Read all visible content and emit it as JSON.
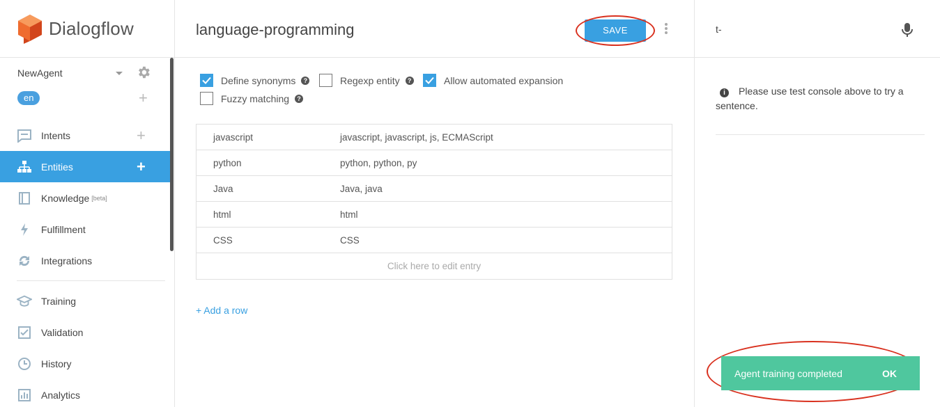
{
  "brand": {
    "name": "Dialogflow",
    "color": "#e8571d"
  },
  "agent": {
    "name": "NewAgent",
    "language": "en"
  },
  "sidebar": {
    "items": [
      {
        "label": "Intents",
        "icon": "chat-icon",
        "plus": "+"
      },
      {
        "label": "Entities",
        "icon": "sitemap-icon",
        "plus": "+",
        "active": true
      },
      {
        "label": "Knowledge",
        "icon": "book-icon",
        "badge": "[beta]"
      },
      {
        "label": "Fulfillment",
        "icon": "bolt-icon"
      },
      {
        "label": "Integrations",
        "icon": "sync-icon"
      },
      {
        "label": "Training",
        "icon": "graduation-cap-icon"
      },
      {
        "label": "Validation",
        "icon": "check-square-icon"
      },
      {
        "label": "History",
        "icon": "clock-icon"
      },
      {
        "label": "Analytics",
        "icon": "bar-chart-icon"
      }
    ],
    "plus": "+"
  },
  "main": {
    "title": "language-programming",
    "save_label": "SAVE",
    "options": [
      {
        "label": "Define synonyms",
        "checked": true,
        "help": "?"
      },
      {
        "label": "Regexp entity",
        "checked": false,
        "help": "?"
      },
      {
        "label": "Allow automated expansion",
        "checked": true
      },
      {
        "label": "Fuzzy matching",
        "checked": false,
        "help": "?"
      }
    ],
    "entries": [
      {
        "value": "javascript",
        "synonyms": "javascript, javascript, js, ECMAScript"
      },
      {
        "value": "python",
        "synonyms": "python, python, py"
      },
      {
        "value": "Java",
        "synonyms": "Java, java"
      },
      {
        "value": "html",
        "synonyms": "html"
      },
      {
        "value": "CSS",
        "synonyms": "CSS"
      }
    ],
    "edit_placeholder": "Click here to edit entry",
    "add_row": "+ Add a row"
  },
  "console": {
    "input_value": "t-",
    "info_icon": "i",
    "info_text": "Please use test console above to try a sentence.",
    "toast_text": "Agent training completed",
    "toast_ok": "OK",
    "toast_color": "#4fc79e"
  },
  "colors": {
    "accent": "#39a0e1",
    "annotation": "#d9311f"
  }
}
